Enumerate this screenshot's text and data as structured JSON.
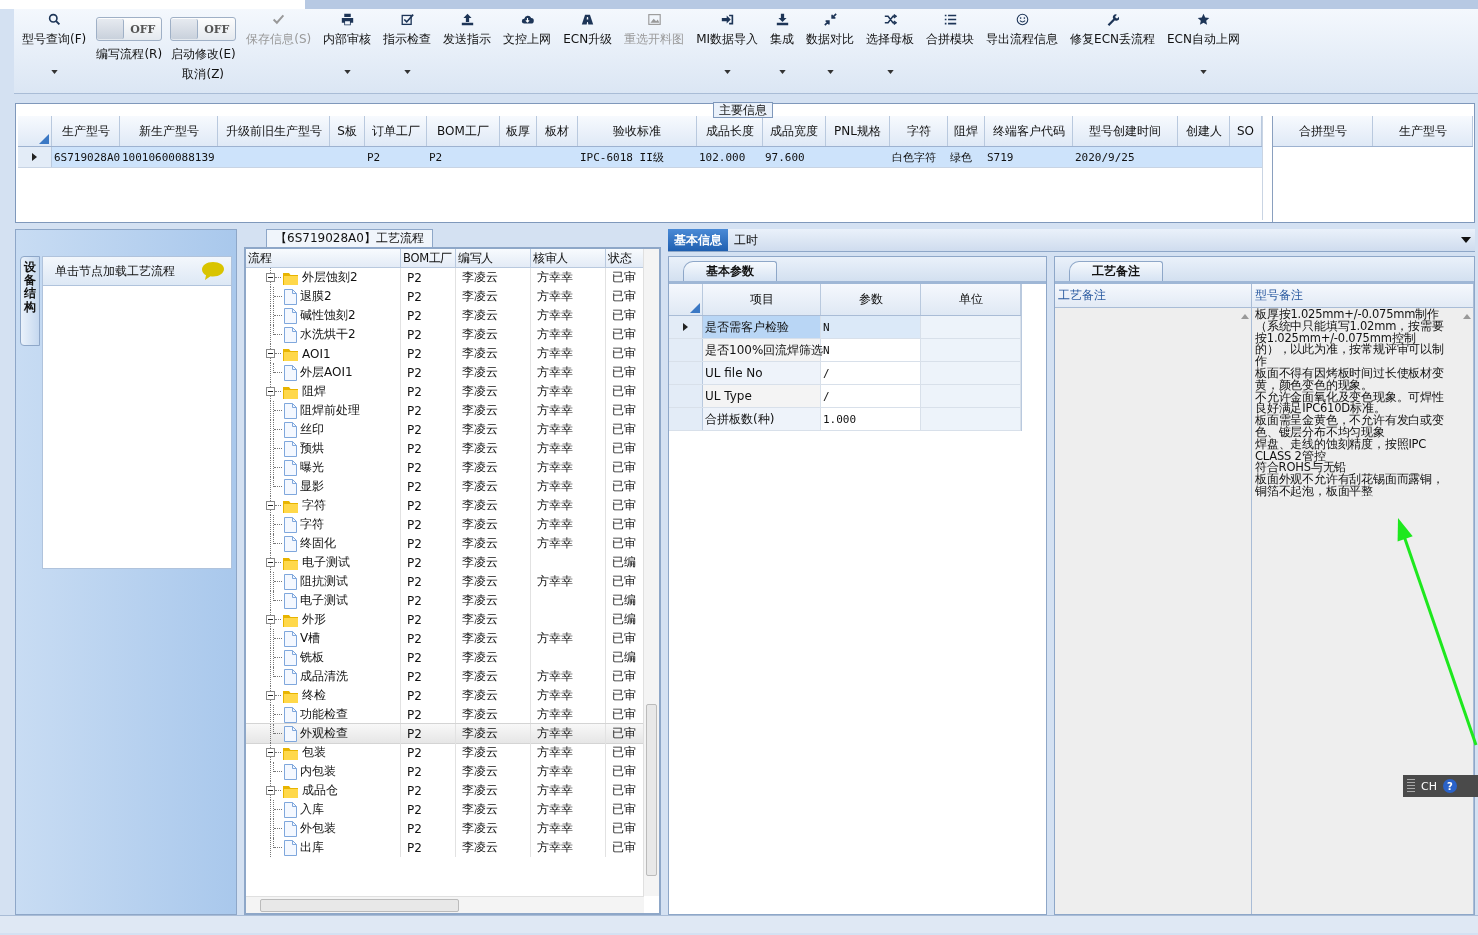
{
  "toolbar": [
    {
      "kind": "button",
      "label": "型号查询(F)",
      "dropdown": true,
      "disabled": false
    },
    {
      "kind": "toggle",
      "toggle_text": "OFF",
      "on": false,
      "label": "编写流程(R)"
    },
    {
      "kind": "toggle",
      "toggle_text": "OFF",
      "on": false,
      "label": "启动修改(E)",
      "label2": "取消(Z)"
    },
    {
      "kind": "button",
      "label": "保存信息(S)",
      "dropdown": false,
      "disabled": true
    },
    {
      "kind": "button",
      "label": "内部审核",
      "dropdown": true,
      "disabled": false
    },
    {
      "kind": "button",
      "label": "指示检查",
      "dropdown": true,
      "disabled": false
    },
    {
      "kind": "button",
      "label": "发送指示",
      "dropdown": false,
      "disabled": false
    },
    {
      "kind": "button",
      "label": "文控上网",
      "dropdown": false,
      "disabled": false
    },
    {
      "kind": "button",
      "label": "ECN升级",
      "dropdown": false,
      "disabled": false
    },
    {
      "kind": "button",
      "label": "重选开料图",
      "dropdown": false,
      "disabled": true
    },
    {
      "kind": "button",
      "label": "MI数据导入",
      "dropdown": true,
      "disabled": false
    },
    {
      "kind": "button",
      "label": "集成",
      "dropdown": true,
      "disabled": false
    },
    {
      "kind": "button",
      "label": "数据对比",
      "dropdown": true,
      "disabled": false
    },
    {
      "kind": "button",
      "label": "选择母板",
      "dropdown": true,
      "disabled": false
    },
    {
      "kind": "button",
      "label": "合拼模块",
      "dropdown": false,
      "disabled": false
    },
    {
      "kind": "button",
      "label": "导出流程信息",
      "dropdown": false,
      "disabled": false
    },
    {
      "kind": "button",
      "label": "修复ECN丢流程",
      "dropdown": false,
      "disabled": false
    },
    {
      "kind": "button",
      "label": "ECN自动上网",
      "dropdown": true,
      "disabled": false
    }
  ],
  "main_info": {
    "title": "主要信息",
    "columns": [
      "生产型号",
      "新生产型号",
      "升级前旧生产型号",
      "S板",
      "订单工厂",
      "BOM工厂",
      "板厚",
      "板材",
      "验收标准",
      "成品长度",
      "成品宽度",
      "PNL规格",
      "字符",
      "阻焊",
      "终端客户代码",
      "型号创建时间",
      "创建人",
      "SO"
    ],
    "rows": [
      {
        "selected": true,
        "cells": [
          "6S719028A0",
          "10010600088139",
          null,
          null,
          "P2",
          "P2",
          null,
          null,
          "IPC-6018 II级",
          "102.000",
          "97.600",
          null,
          "白色字符",
          "绿色",
          "S719",
          "2020/9/25",
          null,
          null
        ]
      }
    ],
    "side_columns": [
      "合拼型号",
      "生产型号"
    ]
  },
  "left_panel": {
    "vertical_tab": "设备结构",
    "load_button": "单击节点加载工艺流程"
  },
  "flow": {
    "title": "【6S719028A0】工艺流程",
    "columns": [
      "流程",
      "BOM工厂",
      "编写人",
      "核审人",
      "状态"
    ],
    "tree": [
      {
        "name": "外层蚀刻2",
        "factory": "P2",
        "writer": "李凌云",
        "reviewer": "方幸幸",
        "status": "已审",
        "expanded": true,
        "selected": false,
        "children": [
          {
            "name": "退膜2",
            "factory": "P2",
            "writer": "李凌云",
            "reviewer": "方幸幸",
            "status": "已审",
            "selected": false
          },
          {
            "name": "碱性蚀刻2",
            "factory": "P2",
            "writer": "李凌云",
            "reviewer": "方幸幸",
            "status": "已审",
            "selected": false
          },
          {
            "name": "水洗烘干2",
            "factory": "P2",
            "writer": "李凌云",
            "reviewer": "方幸幸",
            "status": "已审",
            "selected": false
          }
        ]
      },
      {
        "name": "AOI1",
        "factory": "P2",
        "writer": "李凌云",
        "reviewer": "方幸幸",
        "status": "已审",
        "expanded": true,
        "selected": false,
        "children": [
          {
            "name": "外层AOI1",
            "factory": "P2",
            "writer": "李凌云",
            "reviewer": "方幸幸",
            "status": "已审",
            "selected": false
          }
        ]
      },
      {
        "name": "阻焊",
        "factory": "P2",
        "writer": "李凌云",
        "reviewer": "方幸幸",
        "status": "已审",
        "expanded": true,
        "selected": false,
        "children": [
          {
            "name": "阻焊前处理",
            "factory": "P2",
            "writer": "李凌云",
            "reviewer": "方幸幸",
            "status": "已审",
            "selected": false
          },
          {
            "name": "丝印",
            "factory": "P2",
            "writer": "李凌云",
            "reviewer": "方幸幸",
            "status": "已审",
            "selected": false
          },
          {
            "name": "预烘",
            "factory": "P2",
            "writer": "李凌云",
            "reviewer": "方幸幸",
            "status": "已审",
            "selected": false
          },
          {
            "name": "曝光",
            "factory": "P2",
            "writer": "李凌云",
            "reviewer": "方幸幸",
            "status": "已审",
            "selected": false
          },
          {
            "name": "显影",
            "factory": "P2",
            "writer": "李凌云",
            "reviewer": "方幸幸",
            "status": "已审",
            "selected": false
          }
        ]
      },
      {
        "name": "字符",
        "factory": "P2",
        "writer": "李凌云",
        "reviewer": "方幸幸",
        "status": "已审",
        "expanded": true,
        "selected": false,
        "children": [
          {
            "name": "字符",
            "factory": "P2",
            "writer": "李凌云",
            "reviewer": "方幸幸",
            "status": "已审",
            "selected": false
          },
          {
            "name": "终固化",
            "factory": "P2",
            "writer": "李凌云",
            "reviewer": "方幸幸",
            "status": "已审",
            "selected": false
          }
        ]
      },
      {
        "name": "电子测试",
        "factory": "P2",
        "writer": "李凌云",
        "status": "已编",
        "expanded": true,
        "selected": false,
        "children": [
          {
            "name": "阻抗测试",
            "factory": "P2",
            "writer": "李凌云",
            "reviewer": "方幸幸",
            "status": "已审",
            "selected": false
          },
          {
            "name": "电子测试",
            "factory": "P2",
            "writer": "李凌云",
            "status": "已编",
            "selected": false
          }
        ]
      },
      {
        "name": "外形",
        "factory": "P2",
        "writer": "李凌云",
        "status": "已编",
        "expanded": true,
        "selected": false,
        "children": [
          {
            "name": "V槽",
            "factory": "P2",
            "writer": "李凌云",
            "reviewer": "方幸幸",
            "status": "已审",
            "selected": false
          },
          {
            "name": "铣板",
            "factory": "P2",
            "writer": "李凌云",
            "status": "已编",
            "selected": false
          },
          {
            "name": "成品清洗",
            "factory": "P2",
            "writer": "李凌云",
            "reviewer": "方幸幸",
            "status": "已审",
            "selected": false
          }
        ]
      },
      {
        "name": "终检",
        "factory": "P2",
        "writer": "李凌云",
        "reviewer": "方幸幸",
        "status": "已审",
        "expanded": true,
        "selected": false,
        "children": [
          {
            "name": "功能检查",
            "factory": "P2",
            "writer": "李凌云",
            "reviewer": "方幸幸",
            "status": "已审",
            "selected": false
          },
          {
            "name": "外观检查",
            "factory": "P2",
            "writer": "李凌云",
            "reviewer": "方幸幸",
            "status": "已审",
            "selected": true
          }
        ]
      },
      {
        "name": "包装",
        "factory": "P2",
        "writer": "李凌云",
        "reviewer": "方幸幸",
        "status": "已审",
        "expanded": true,
        "selected": false,
        "children": [
          {
            "name": "内包装",
            "factory": "P2",
            "writer": "李凌云",
            "reviewer": "方幸幸",
            "status": "已审",
            "selected": false
          }
        ]
      },
      {
        "name": "成品仓",
        "factory": "P2",
        "writer": "李凌云",
        "reviewer": "方幸幸",
        "status": "已审",
        "expanded": true,
        "selected": false,
        "children": [
          {
            "name": "入库",
            "factory": "P2",
            "writer": "李凌云",
            "reviewer": "方幸幸",
            "status": "已审",
            "selected": false
          },
          {
            "name": "外包装",
            "factory": "P2",
            "writer": "李凌云",
            "reviewer": "方幸幸",
            "status": "已审",
            "selected": false
          },
          {
            "name": "出库",
            "factory": "P2",
            "writer": "李凌云",
            "reviewer": "方幸幸",
            "status": "已审",
            "selected": false
          }
        ]
      }
    ]
  },
  "detail_tabs": [
    {
      "label": "基本信息",
      "selected": true
    },
    {
      "label": "工时",
      "selected": false
    }
  ],
  "basic_params": {
    "tab": "基本参数",
    "columns": [
      "项目",
      "参数",
      "单位"
    ],
    "rows": [
      {
        "item": "是否需客户检验",
        "value": "N",
        "selected": true
      },
      {
        "item": "是否100%回流焊筛选",
        "value": "N",
        "selected": false
      },
      {
        "item": "UL file No",
        "value": "/",
        "selected": false
      },
      {
        "item": "UL Type",
        "value": "/",
        "selected": false
      },
      {
        "item": "合拼板数(种)",
        "value": "1.000",
        "selected": false
      }
    ]
  },
  "process_notes": {
    "tab": "工艺备注",
    "columns": [
      "工艺备注",
      "型号备注"
    ],
    "model_note": [
      "板厚按1.025mm+/-0.075mm制作（系统中只能填写1.02mm，按需要按1.025mm+/-0.075mm控制的），以此为准，按常规评审可以制作",
      "板面不得有因烤板时间过长使板材变黄，颜色变色的现象。",
      "不允许金面氧化及变色现象。可焊性良好满足IPC610D标准。",
      "板面需呈金黄色，不允许有发白或变色、镀层分布不均匀现象",
      "焊盘、走线的蚀刻精度，按照IPC CLASS 2管控",
      "符合ROHS与无铅",
      "板面外观不允许有刮花锡面而露铜，铜箔不起泡，板面平整"
    ]
  },
  "ime": {
    "label": "CH",
    "help": "?"
  }
}
